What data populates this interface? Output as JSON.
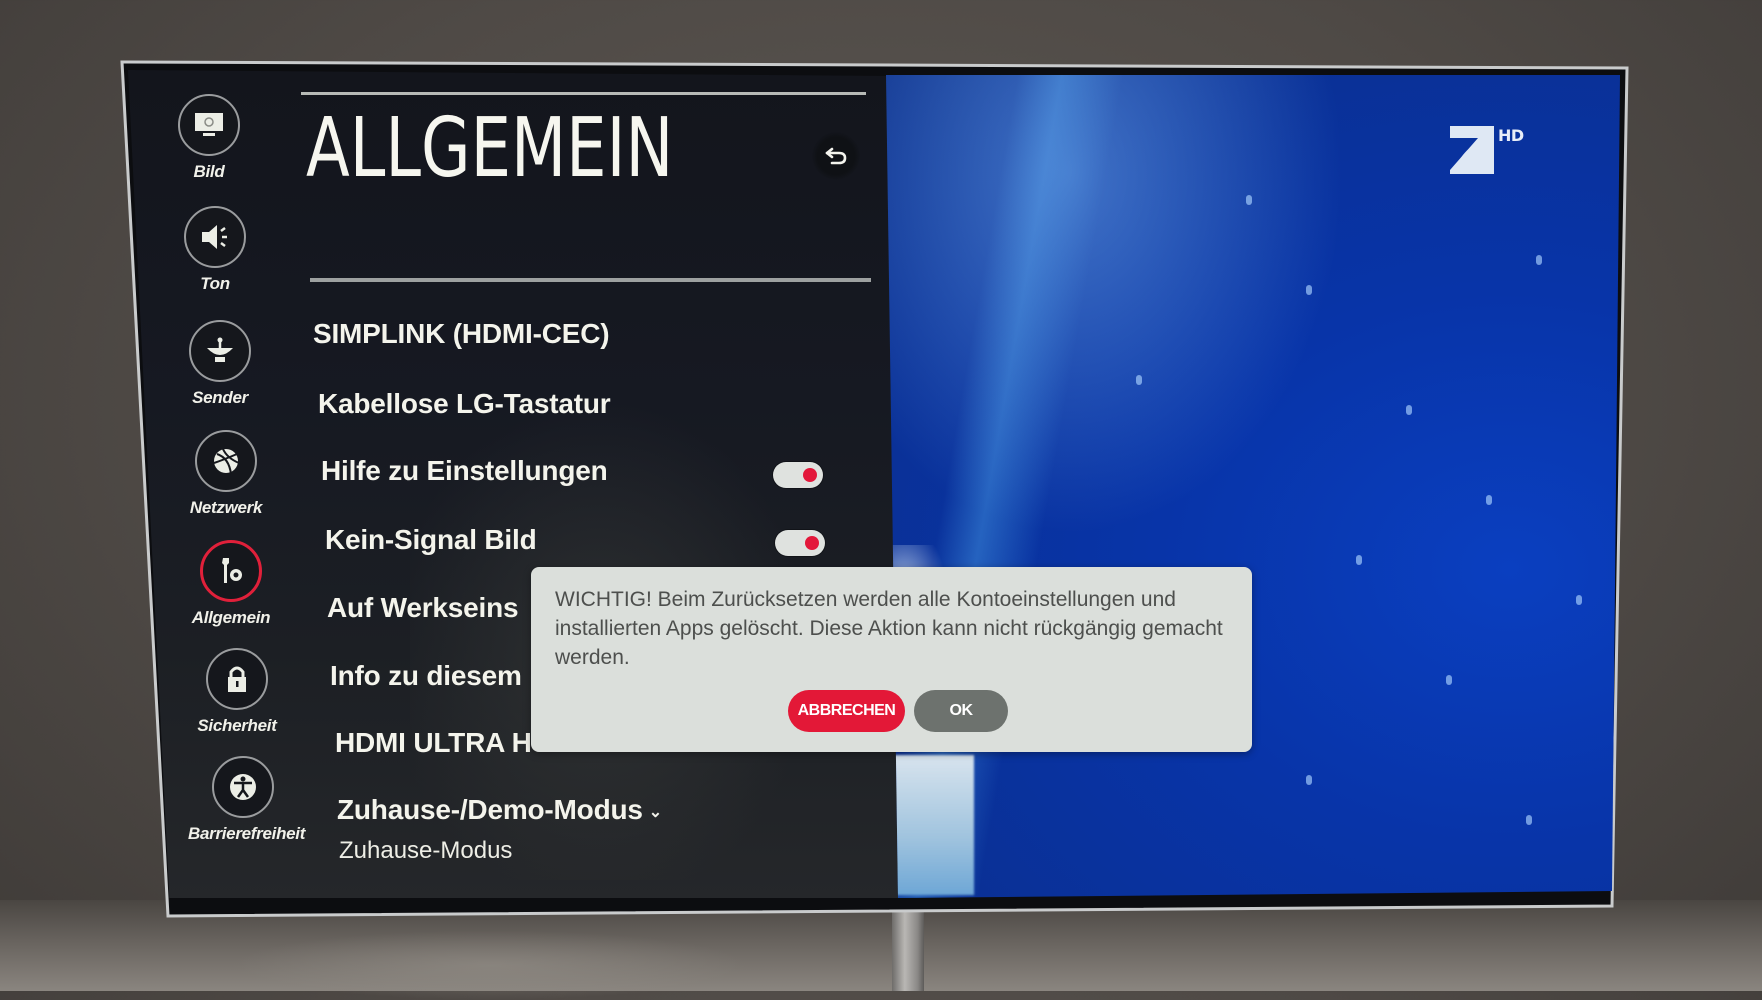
{
  "sidebar": {
    "items": [
      {
        "label": "Bild",
        "icon": "picture-icon",
        "active": false
      },
      {
        "label": "Ton",
        "icon": "speaker-icon",
        "active": false
      },
      {
        "label": "Sender",
        "icon": "satellite-dish-icon",
        "active": false
      },
      {
        "label": "Netzwerk",
        "icon": "globe-icon",
        "active": false
      },
      {
        "label": "Allgemein",
        "icon": "wrench-gear-icon",
        "active": true
      },
      {
        "label": "Sicherheit",
        "icon": "lock-icon",
        "active": false
      },
      {
        "label": "Barrierefreiheit",
        "icon": "accessibility-icon",
        "active": false
      }
    ]
  },
  "header": {
    "title": "ALLGEMEIN",
    "back_icon": "back-arrow-icon"
  },
  "menu": {
    "items": [
      {
        "label": "SIMPLINK (HDMI-CEC)"
      },
      {
        "label": "Kabellose LG-Tastatur"
      },
      {
        "label": "Hilfe zu Einstellungen",
        "toggle": true
      },
      {
        "label": "Kein-Signal Bild",
        "toggle": true
      },
      {
        "label": "Auf Werkseins"
      },
      {
        "label": "Info zu diesem"
      },
      {
        "label": "HDMI ULTRA H"
      },
      {
        "label": "Zuhause-/Demo-Modus",
        "value": "Zuhause-Modus",
        "expandable": true
      }
    ]
  },
  "dialog": {
    "message": "WICHTIG! Beim Zurücksetzen werden alle Kontoeinstellungen und installierten Apps gelöscht. Diese Aktion kann nicht rückgängig gemacht werden.",
    "cancel_label": "ABBRECHEN",
    "ok_label": "OK"
  },
  "video": {
    "channel_logo": "7",
    "channel_badge": "HD"
  },
  "colors": {
    "accent": "#e31837",
    "panel": "#15171c",
    "dialog_bg": "#dbdfdb",
    "ok_button": "#6d726e",
    "video_blue": "#0a3fc0"
  }
}
